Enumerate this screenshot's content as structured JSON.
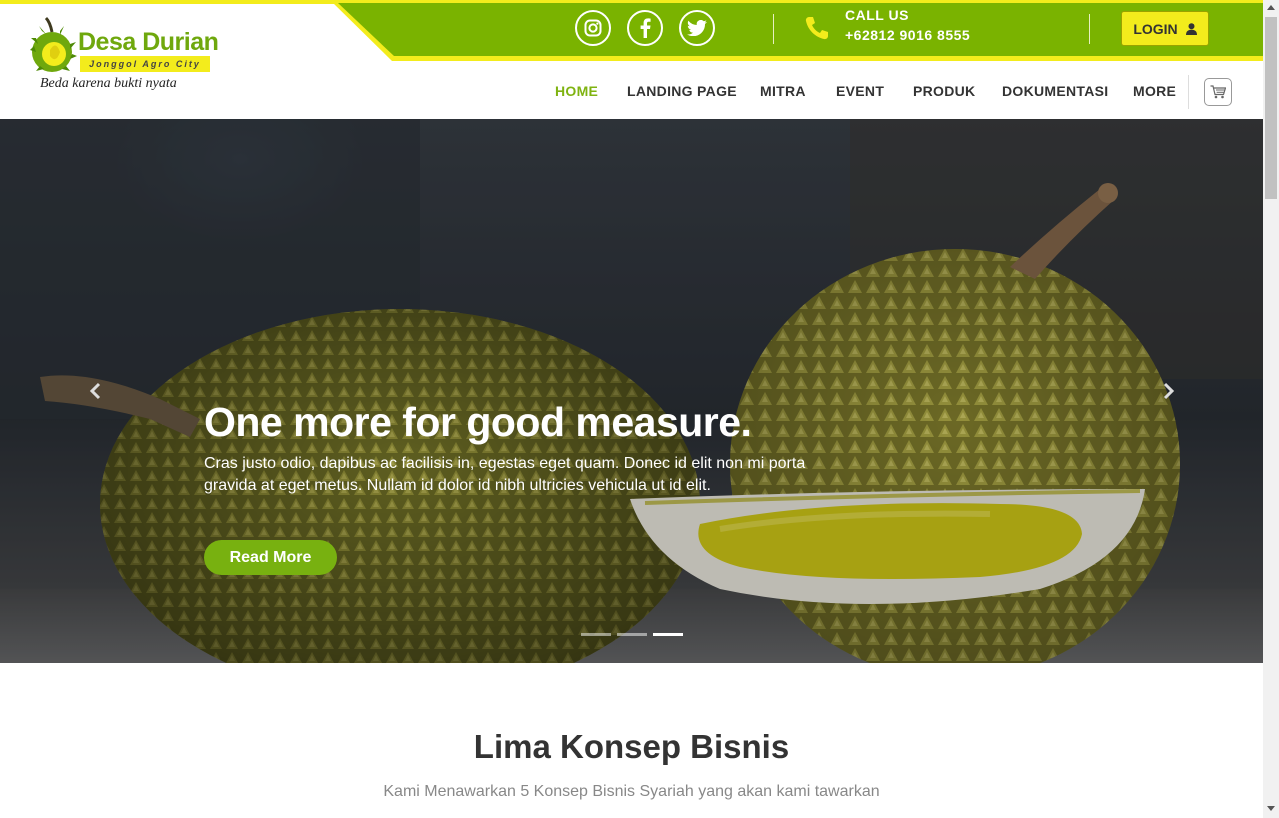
{
  "brand": {
    "name": "Desa Durian",
    "subtitle": "Jonggol Agro City",
    "tagline": "Beda karena bukti nyata"
  },
  "topbar": {
    "social": [
      "instagram-icon",
      "facebook-icon",
      "twitter-icon"
    ],
    "call_title": "CALL US",
    "call_number": "+62812 9016 8555",
    "login_label": "LOGIN"
  },
  "nav": {
    "items": [
      {
        "label": "HOME",
        "active": true
      },
      {
        "label": "LANDING PAGE",
        "active": false
      },
      {
        "label": "MITRA",
        "active": false
      },
      {
        "label": "EVENT",
        "active": false
      },
      {
        "label": "PRODUK",
        "active": false
      },
      {
        "label": "DOKUMENTASI",
        "active": false
      },
      {
        "label": "MORE",
        "active": false
      }
    ],
    "cart_icon": "cart-icon"
  },
  "hero": {
    "title": "One more for good measure.",
    "text": "Cras justo odio, dapibus ac facilisis in, egestas eget quam. Donec id elit non mi porta gravida at eget metus. Nullam id dolor id nibh ultricies vehicula ut id elit.",
    "button_label": "Read More",
    "slide_count": 3,
    "active_slide": 3
  },
  "section": {
    "title": "Lima Konsep Bisnis",
    "subtitle": "Kami Menawarkan 5 Konsep Bisnis Syariah yang akan kami tawarkan"
  },
  "colors": {
    "brand_green": "#7fb311",
    "brand_yellow": "#f3ec1c",
    "topbar_green": "#7ab300"
  }
}
